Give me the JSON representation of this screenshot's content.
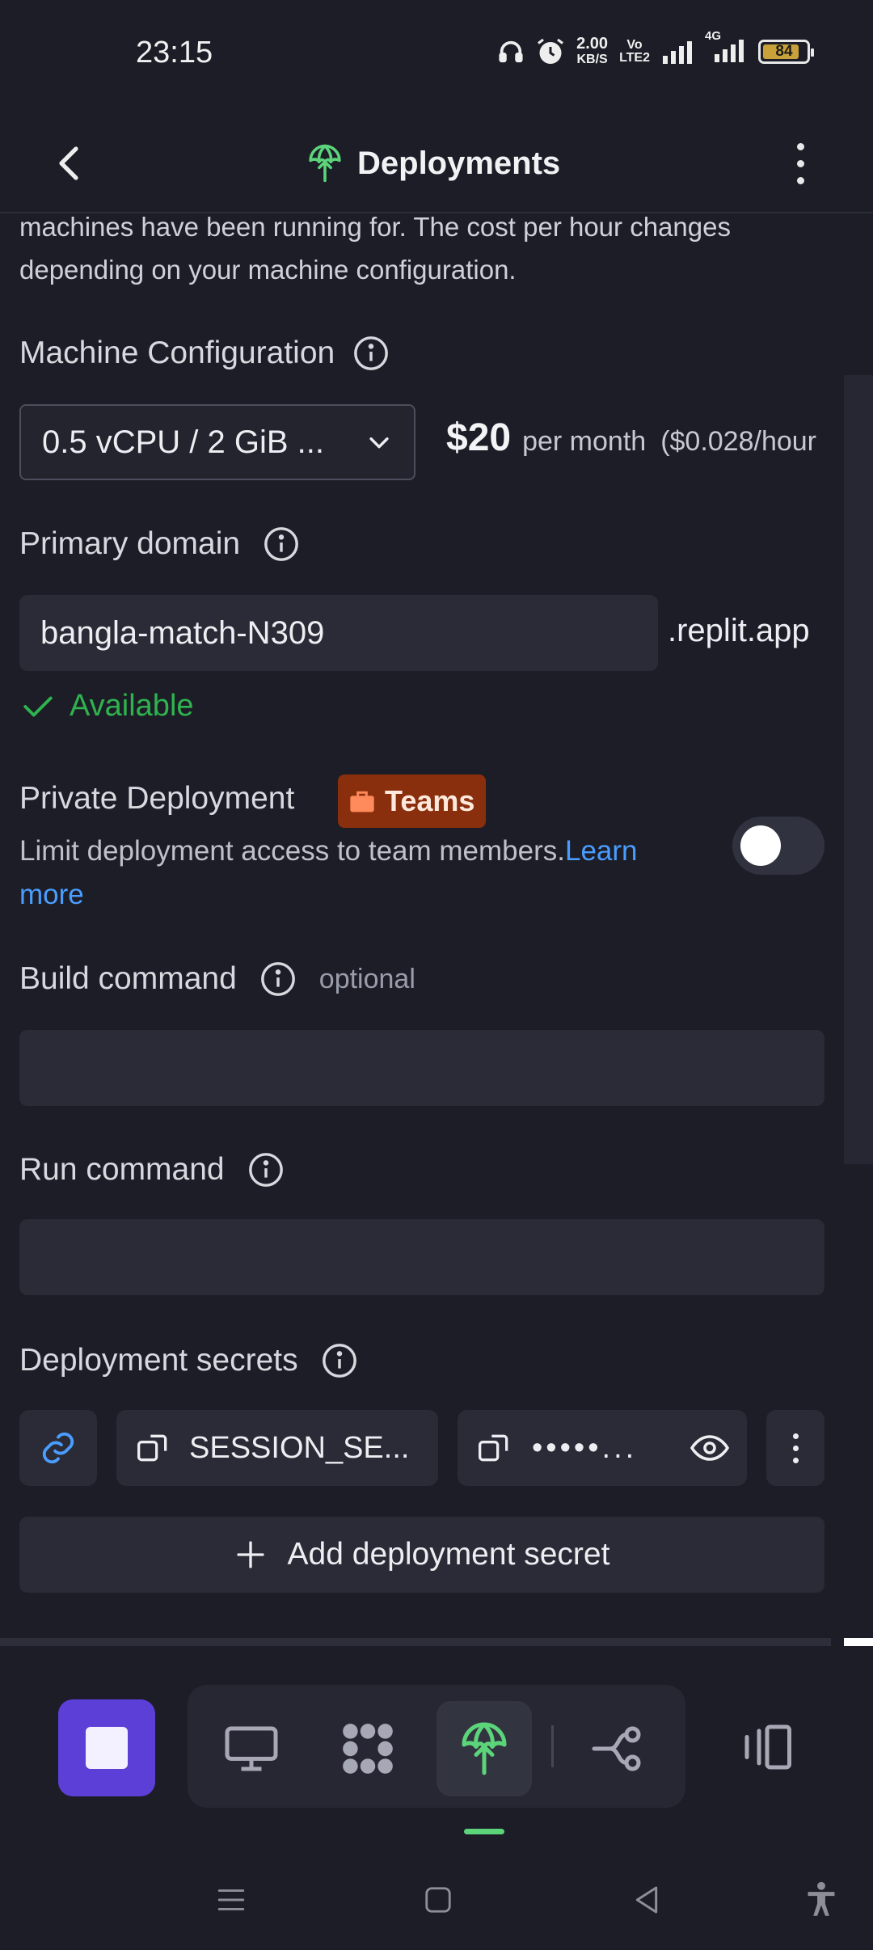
{
  "status_bar": {
    "time": "23:15",
    "net_speed_value": "2.00",
    "net_speed_unit": "KB/S",
    "volte_top": "Vo",
    "volte_bottom": "LTE2",
    "network_4g": "4G",
    "battery_level": "84",
    "battery_fraction": 0.84,
    "icons": [
      "headphones-icon",
      "alarm-icon",
      "signal-icon",
      "signal-4g-icon",
      "battery-icon"
    ]
  },
  "header": {
    "title": "Deployments",
    "back_icon": "chevron-left-icon",
    "title_icon": "deployment-icon",
    "menu_icon": "kebab-menu-icon"
  },
  "description": "machines have been running for. The cost per hour changes depending on your machine configuration.",
  "machine": {
    "label": "Machine Configuration",
    "selected": "0.5 vCPU / 2 GiB ...",
    "price": "$20",
    "price_unit": "per month",
    "price_hourly": "($0.028/hour"
  },
  "domain": {
    "label": "Primary domain",
    "value": "bangla-match-N309",
    "suffix": ".replit.app",
    "status": "Available"
  },
  "private": {
    "label": "Private Deployment",
    "badge": "Teams",
    "description": "Limit deployment access to team members.",
    "link": "Learn more",
    "enabled": false
  },
  "build": {
    "label": "Build command",
    "optional": "optional",
    "value": ""
  },
  "run": {
    "label": "Run command",
    "value": ""
  },
  "secrets": {
    "label": "Deployment secrets",
    "key": "SESSION_SE...",
    "masked_value": "•••••...",
    "add_label": "Add deployment secret"
  },
  "colors": {
    "background": "#1c1d26",
    "surface": "#2a2b36",
    "accent_green": "#5bd47a",
    "available_green": "#2fb34f",
    "link_blue": "#4a9dff",
    "stop_purple": "#5b3fd6",
    "teams_badge": "#8a2f0d"
  }
}
